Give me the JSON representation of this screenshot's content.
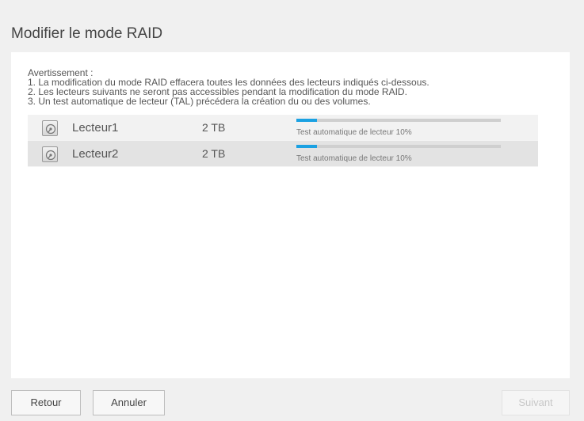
{
  "page": {
    "title": "Modifier le mode RAID"
  },
  "warning": {
    "heading": "Avertissement :",
    "lines": [
      "1. La modification du mode RAID effacera toutes les données des lecteurs indiqués ci-dessous.",
      "2. Les lecteurs suivants ne seront pas accessibles pendant la modification du mode RAID.",
      "3. Un test automatique de lecteur (TAL) précédera la création du ou des volumes."
    ]
  },
  "drives": [
    {
      "icon": "hard-drive-icon",
      "name": "Lecteur1",
      "size": "2 TB",
      "progress_percent": 10,
      "status": "Test automatique de lecteur 10%"
    },
    {
      "icon": "hard-drive-icon",
      "name": "Lecteur2",
      "size": "2 TB",
      "progress_percent": 10,
      "status": "Test automatique de lecteur 10%"
    }
  ],
  "buttons": {
    "back": "Retour",
    "cancel": "Annuler",
    "next": "Suivant"
  },
  "colors": {
    "progress_accent": "#1ba1e2",
    "next_disabled_text": "#c8c8c8"
  }
}
